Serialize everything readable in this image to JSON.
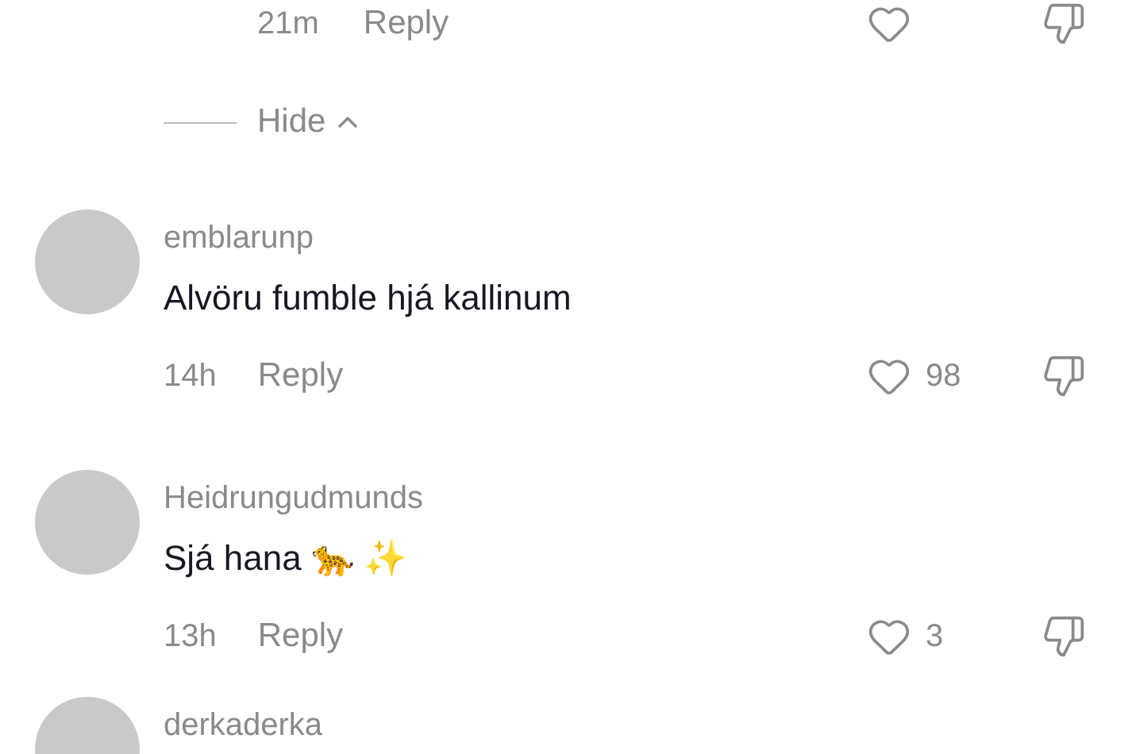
{
  "top_reply": {
    "time": "21m",
    "reply": "Reply"
  },
  "hide": {
    "label": "Hide"
  },
  "comments": [
    {
      "username": "emblarunp",
      "text": "Alvöru fumble hjá kallinum",
      "time": "14h",
      "reply": "Reply",
      "likes": "98"
    },
    {
      "username": "Heidrungudmunds",
      "text": "Sjá hana 🐆 ✨",
      "time": "13h",
      "reply": "Reply",
      "likes": "3"
    },
    {
      "username": "derkaderka"
    }
  ]
}
